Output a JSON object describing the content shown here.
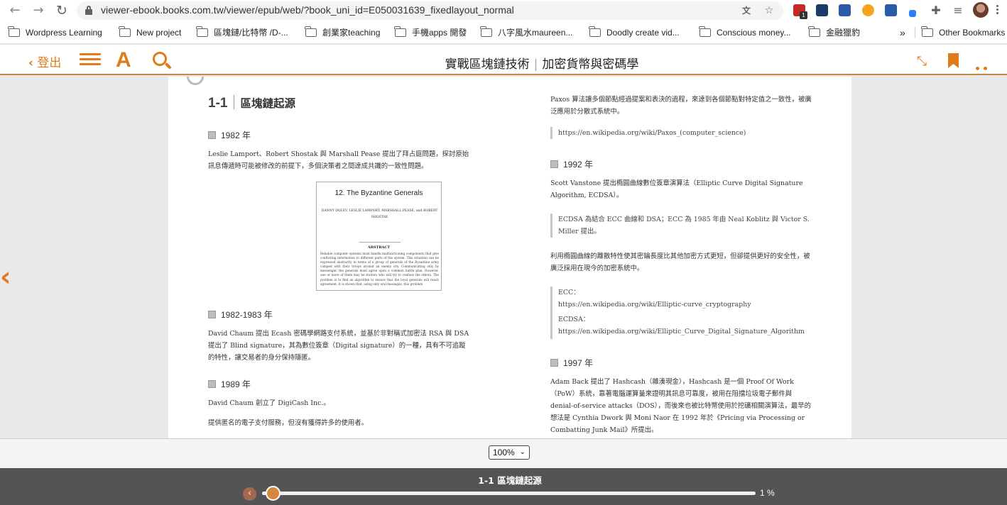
{
  "browser": {
    "url": "viewer-ebook.books.com.tw/viewer/epub/web/?book_uni_id=E050031639_fixedlayout_normal",
    "bookmarks": [
      "Wordpress Learning",
      "New project",
      "區塊鏈/比特幣 /D-...",
      "創業家teaching",
      "手機apps 開發",
      "八字風水maureen...",
      "Doodly create vid...",
      "Conscious money...",
      "金融獵豹"
    ],
    "overflow": "»",
    "other_bookmarks": "Other Bookmarks",
    "ext_badge": "1"
  },
  "reader": {
    "logout_label": "登出",
    "book_title": "實戰區塊鏈技術",
    "book_subtitle": "加密貨幣與密碼學",
    "font_label": "A",
    "zoom": "100%",
    "chapter_label": "1-1 區塊鏈起源",
    "progress_label": "1 %",
    "progress_fraction": 0.01
  },
  "page": {
    "chapter_num": "1-1",
    "chapter_name": "區塊鏈起源",
    "left": {
      "y1982": "1982 年",
      "p1982": "Leslie Lamport、Robert Shostak 與 Marshall Pease 提出了拜占庭問題，探討原始訊息傳遞時可能被修改的前提下，多個決策者之間達成共識的一致性問題。",
      "y1982_1983": "1982-1983 年",
      "p1982_1983": "David Chaum 提出 Ecash 密碼學網路支付系統，並基於非對稱式加密法 RSA 與 DSA 提出了 Blind signature，其為數位簽章（Digital signature）的一種，具有不可追蹤的特性，讓交易者的身分保持隱匿。",
      "y1989": "1989 年",
      "p1989a": "David Chaum 創立了 DigiCash Inc.。",
      "p1989b": "提供匿名的電子支付服務，但沒有獲得許多的使用者。"
    },
    "figure": {
      "title": "12.  The Byzantine Generals",
      "authors": "DANNY DOLEV, LESLIE LAMPORT, MARSHALL PEASE, and ROBERT SHOSTAK",
      "abstract_head": "ABSTRACT",
      "abstract": "Reliable computer systems must handle malfunctioning components that give conflicting information to different parts of the system. This situation can be expressed abstractly in terms of a group of generals of the Byzantine army camped with their troops around an enemy city. Communicating only by messenger, the generals must agree upon a common battle plan. However, one or more of them may be traitors who will try to confuse the others. The problem is to find an algorithm to ensure that the loyal generals will reach agreement. It is shown that, using only oral messages, this problem"
    },
    "right": {
      "p_paxos": "Paxos 算法讓多個節點經過提案和表決的過程，來達到各個節點對特定值之一致性，被廣泛應用於分散式系統中。",
      "q_paxos": "https://en.wikipedia.org/wiki/Paxos_(computer_science)",
      "y1992": "1992 年",
      "p1992": "Scott Vanstone 提出橢圓曲線數位簽章演算法（Elliptic Curve Digital Signature Algorithm, ECDSA）。",
      "q_ecdsa": "ECDSA 為結合 ECC 曲線和 DSA；ECC 為 1985 年由 Neal Koblitz 與 Victor S. Miller 提出。",
      "p_ecc": "利用橢圓曲線的離散特性使其密鑰長度比其他加密方式更短，但卻提供更好的安全性，被廣泛採用在現今的加密系統中。",
      "q_ecc_label": "ECC：",
      "q_ecc_url": "https://en.wikipedia.org/wiki/Elliptic-curve_cryptography",
      "q_ecdsa_label": "ECDSA：",
      "q_ecdsa_url": "https://en.wikipedia.org/wiki/Elliptic_Curve_Digital_Signature_Algorithm",
      "y1997": "1997 年",
      "p1997": "Adam Back 提出了 Hashcash（雜湊現金），Hashcash 是一個 Proof Of Work（PoW）系統，靠著電腦運算量來證明其訊息可靠度，被用在阻擋垃圾電子郵件與 denial-of-service attacks（DOS），而後來也被比特幣使用於挖礦相關演算法，最早的想法是 Cynthia Dwork 與 Moni Naor 在 1992 年於《Pricing via Processing or Combatting Junk Mail》所提出。"
    }
  },
  "colors": {
    "accent": "#e07b1c",
    "bottom_bar": "#545454",
    "thumb": "#d6863f"
  }
}
